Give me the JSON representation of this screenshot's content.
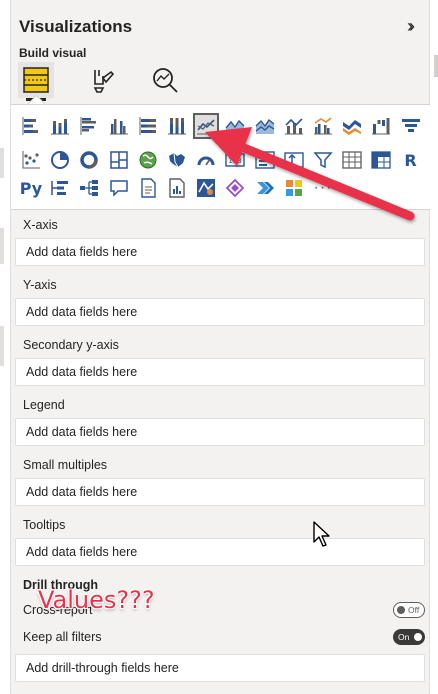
{
  "panel": {
    "title": "Visualizations",
    "collapse_icon": "double-chevron-right",
    "subtitle": "Build visual",
    "modes": [
      {
        "name": "build-visual",
        "active": true
      },
      {
        "name": "format-visual",
        "active": false
      },
      {
        "name": "analytics",
        "active": false
      }
    ]
  },
  "gallery": {
    "selected": "line-chart",
    "rows": [
      [
        "stacked-bar-chart",
        "stacked-column-chart",
        "clustered-bar-chart",
        "clustered-column-chart",
        "100-stacked-bar-chart",
        "100-stacked-column-chart",
        "line-chart",
        "area-chart",
        "stacked-area-chart",
        "line-and-stacked-column-chart",
        "line-and-clustered-column-chart",
        "ribbon-chart",
        "waterfall-chart",
        "funnel-chart"
      ],
      [
        "scatter-chart",
        "pie-chart",
        "donut-chart",
        "treemap",
        "map",
        "filled-map",
        "gauge",
        "card",
        "multi-row-card",
        "kpi",
        "slicer",
        "table",
        "matrix",
        "r-script-visual"
      ],
      [
        "python-visual",
        "key-influencers",
        "decomposition-tree",
        "qa",
        "smart-narrative",
        "paginated-report",
        "arcgis-map",
        "power-apps",
        "power-automate",
        "custom-visual",
        "more-visuals"
      ]
    ],
    "r_text": "R",
    "py_text": "Py",
    "more_text": "···"
  },
  "wells": [
    {
      "label": "X-axis",
      "placeholder": "Add data fields here"
    },
    {
      "label": "Y-axis",
      "placeholder": "Add data fields here"
    },
    {
      "label": "Secondary y-axis",
      "placeholder": "Add data fields here"
    },
    {
      "label": "Legend",
      "placeholder": "Add data fields here"
    },
    {
      "label": "Small multiples",
      "placeholder": "Add data fields here"
    },
    {
      "label": "Tooltips",
      "placeholder": "Add data fields here"
    }
  ],
  "drill": {
    "title": "Drill through",
    "cross_report": {
      "label": "Cross-report",
      "state": "Off"
    },
    "keep_filters": {
      "label": "Keep all filters",
      "state": "On"
    },
    "placeholder": "Add drill-through fields here"
  },
  "annotation": {
    "text": "Values???",
    "color": "#e8334a"
  },
  "colors": {
    "accent": "#f2c811",
    "panel_bg": "#f3f2f1",
    "arrow": "#e8334a"
  }
}
